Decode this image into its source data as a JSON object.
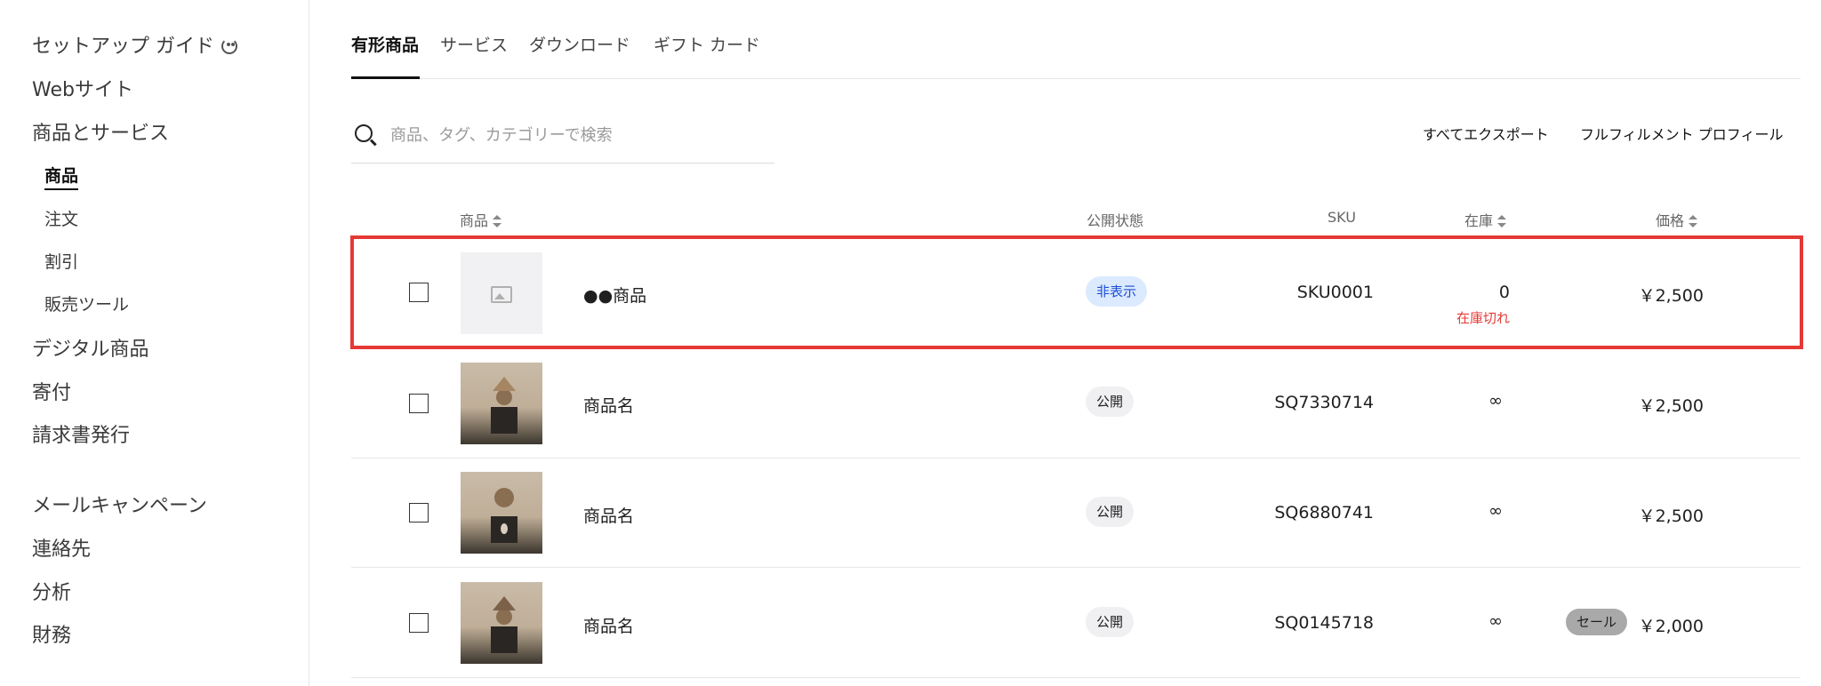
{
  "sidebar": {
    "items": [
      {
        "label": "セットアップ ガイド"
      },
      {
        "label": "Webサイト"
      },
      {
        "label": "商品とサービス"
      },
      {
        "label": "商品"
      },
      {
        "label": "注文"
      },
      {
        "label": "割引"
      },
      {
        "label": "販売ツール"
      },
      {
        "label": "デジタル商品"
      },
      {
        "label": "寄付"
      },
      {
        "label": "請求書発行"
      },
      {
        "label": "メールキャンペーン"
      },
      {
        "label": "連絡先"
      },
      {
        "label": "分析"
      },
      {
        "label": "財務"
      }
    ]
  },
  "tabs": [
    {
      "label": "有形商品",
      "active": true
    },
    {
      "label": "サービス"
    },
    {
      "label": "ダウンロード"
    },
    {
      "label": "ギフト カード"
    }
  ],
  "search": {
    "placeholder": "商品、タグ、カテゴリーで検索"
  },
  "actions": {
    "export_all": "すべてエクスポート",
    "fulfillment_profile": "フルフィルメント プロフィール"
  },
  "table": {
    "headers": {
      "product": "商品",
      "visibility": "公開状態",
      "sku": "SKU",
      "stock": "在庫",
      "price": "価格"
    },
    "rows": [
      {
        "name": "●●商品",
        "visibility": "非表示",
        "sku": "SKU0001",
        "stock": "0",
        "stock_status": "在庫切れ",
        "price": "￥2,500",
        "image": "placeholder-icon",
        "selected": false,
        "highlighted": true
      },
      {
        "name": "商品名",
        "visibility": "公開",
        "sku": "SQ7330714",
        "stock": "∞",
        "price": "￥2,500",
        "image": "sculpture-photo",
        "selected": false
      },
      {
        "name": "商品名",
        "visibility": "公開",
        "sku": "SQ6880741",
        "stock": "∞",
        "price": "￥2,500",
        "image": "sculpture-photo",
        "selected": false
      },
      {
        "name": "商品名",
        "visibility": "公開",
        "sku": "SQ0145718",
        "stock": "∞",
        "price": "￥2,000",
        "sale": "セール",
        "image": "sculpture-photo",
        "selected": false
      }
    ]
  },
  "colors": {
    "highlight": "#e53935",
    "hidden_badge_bg": "#dbeafe",
    "hidden_badge_text": "#1d4ed8",
    "out_of_stock": "#e53935",
    "sale_badge_bg": "#a9a9a9"
  }
}
